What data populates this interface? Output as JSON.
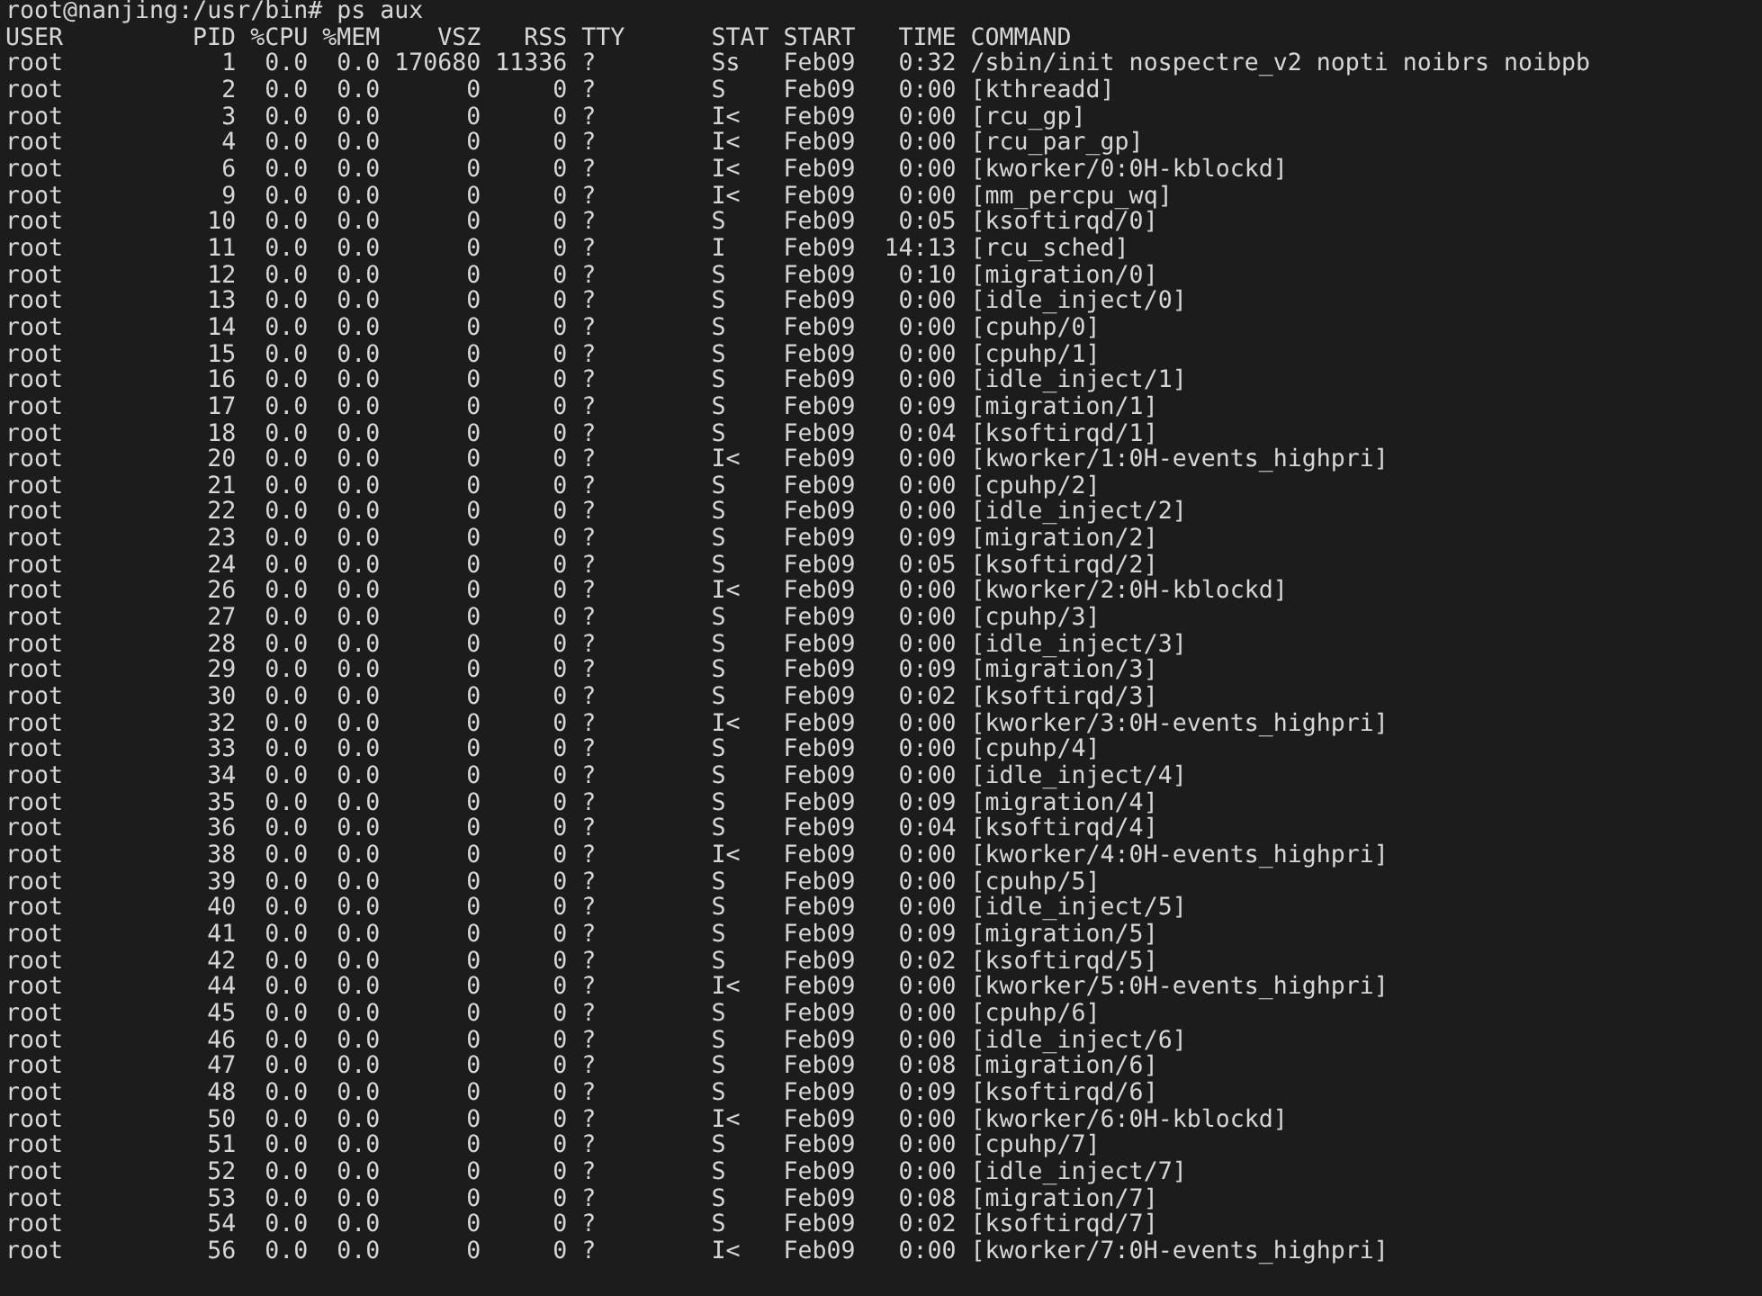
{
  "terminal": {
    "prompt": "root@nanjing:/usr/bin# ps aux",
    "columns": [
      "USER",
      "PID",
      "%CPU",
      "%MEM",
      "VSZ",
      "RSS",
      "TTY",
      "STAT",
      "START",
      "TIME",
      "COMMAND"
    ],
    "rows": [
      [
        "root",
        "1",
        "0.0",
        "0.0",
        "170680",
        "11336",
        "?",
        "Ss",
        "Feb09",
        "0:32",
        "/sbin/init nospectre_v2 nopti noibrs noibpb"
      ],
      [
        "root",
        "2",
        "0.0",
        "0.0",
        "0",
        "0",
        "?",
        "S",
        "Feb09",
        "0:00",
        "[kthreadd]"
      ],
      [
        "root",
        "3",
        "0.0",
        "0.0",
        "0",
        "0",
        "?",
        "I<",
        "Feb09",
        "0:00",
        "[rcu_gp]"
      ],
      [
        "root",
        "4",
        "0.0",
        "0.0",
        "0",
        "0",
        "?",
        "I<",
        "Feb09",
        "0:00",
        "[rcu_par_gp]"
      ],
      [
        "root",
        "6",
        "0.0",
        "0.0",
        "0",
        "0",
        "?",
        "I<",
        "Feb09",
        "0:00",
        "[kworker/0:0H-kblockd]"
      ],
      [
        "root",
        "9",
        "0.0",
        "0.0",
        "0",
        "0",
        "?",
        "I<",
        "Feb09",
        "0:00",
        "[mm_percpu_wq]"
      ],
      [
        "root",
        "10",
        "0.0",
        "0.0",
        "0",
        "0",
        "?",
        "S",
        "Feb09",
        "0:05",
        "[ksoftirqd/0]"
      ],
      [
        "root",
        "11",
        "0.0",
        "0.0",
        "0",
        "0",
        "?",
        "I",
        "Feb09",
        "14:13",
        "[rcu_sched]"
      ],
      [
        "root",
        "12",
        "0.0",
        "0.0",
        "0",
        "0",
        "?",
        "S",
        "Feb09",
        "0:10",
        "[migration/0]"
      ],
      [
        "root",
        "13",
        "0.0",
        "0.0",
        "0",
        "0",
        "?",
        "S",
        "Feb09",
        "0:00",
        "[idle_inject/0]"
      ],
      [
        "root",
        "14",
        "0.0",
        "0.0",
        "0",
        "0",
        "?",
        "S",
        "Feb09",
        "0:00",
        "[cpuhp/0]"
      ],
      [
        "root",
        "15",
        "0.0",
        "0.0",
        "0",
        "0",
        "?",
        "S",
        "Feb09",
        "0:00",
        "[cpuhp/1]"
      ],
      [
        "root",
        "16",
        "0.0",
        "0.0",
        "0",
        "0",
        "?",
        "S",
        "Feb09",
        "0:00",
        "[idle_inject/1]"
      ],
      [
        "root",
        "17",
        "0.0",
        "0.0",
        "0",
        "0",
        "?",
        "S",
        "Feb09",
        "0:09",
        "[migration/1]"
      ],
      [
        "root",
        "18",
        "0.0",
        "0.0",
        "0",
        "0",
        "?",
        "S",
        "Feb09",
        "0:04",
        "[ksoftirqd/1]"
      ],
      [
        "root",
        "20",
        "0.0",
        "0.0",
        "0",
        "0",
        "?",
        "I<",
        "Feb09",
        "0:00",
        "[kworker/1:0H-events_highpri]"
      ],
      [
        "root",
        "21",
        "0.0",
        "0.0",
        "0",
        "0",
        "?",
        "S",
        "Feb09",
        "0:00",
        "[cpuhp/2]"
      ],
      [
        "root",
        "22",
        "0.0",
        "0.0",
        "0",
        "0",
        "?",
        "S",
        "Feb09",
        "0:00",
        "[idle_inject/2]"
      ],
      [
        "root",
        "23",
        "0.0",
        "0.0",
        "0",
        "0",
        "?",
        "S",
        "Feb09",
        "0:09",
        "[migration/2]"
      ],
      [
        "root",
        "24",
        "0.0",
        "0.0",
        "0",
        "0",
        "?",
        "S",
        "Feb09",
        "0:05",
        "[ksoftirqd/2]"
      ],
      [
        "root",
        "26",
        "0.0",
        "0.0",
        "0",
        "0",
        "?",
        "I<",
        "Feb09",
        "0:00",
        "[kworker/2:0H-kblockd]"
      ],
      [
        "root",
        "27",
        "0.0",
        "0.0",
        "0",
        "0",
        "?",
        "S",
        "Feb09",
        "0:00",
        "[cpuhp/3]"
      ],
      [
        "root",
        "28",
        "0.0",
        "0.0",
        "0",
        "0",
        "?",
        "S",
        "Feb09",
        "0:00",
        "[idle_inject/3]"
      ],
      [
        "root",
        "29",
        "0.0",
        "0.0",
        "0",
        "0",
        "?",
        "S",
        "Feb09",
        "0:09",
        "[migration/3]"
      ],
      [
        "root",
        "30",
        "0.0",
        "0.0",
        "0",
        "0",
        "?",
        "S",
        "Feb09",
        "0:02",
        "[ksoftirqd/3]"
      ],
      [
        "root",
        "32",
        "0.0",
        "0.0",
        "0",
        "0",
        "?",
        "I<",
        "Feb09",
        "0:00",
        "[kworker/3:0H-events_highpri]"
      ],
      [
        "root",
        "33",
        "0.0",
        "0.0",
        "0",
        "0",
        "?",
        "S",
        "Feb09",
        "0:00",
        "[cpuhp/4]"
      ],
      [
        "root",
        "34",
        "0.0",
        "0.0",
        "0",
        "0",
        "?",
        "S",
        "Feb09",
        "0:00",
        "[idle_inject/4]"
      ],
      [
        "root",
        "35",
        "0.0",
        "0.0",
        "0",
        "0",
        "?",
        "S",
        "Feb09",
        "0:09",
        "[migration/4]"
      ],
      [
        "root",
        "36",
        "0.0",
        "0.0",
        "0",
        "0",
        "?",
        "S",
        "Feb09",
        "0:04",
        "[ksoftirqd/4]"
      ],
      [
        "root",
        "38",
        "0.0",
        "0.0",
        "0",
        "0",
        "?",
        "I<",
        "Feb09",
        "0:00",
        "[kworker/4:0H-events_highpri]"
      ],
      [
        "root",
        "39",
        "0.0",
        "0.0",
        "0",
        "0",
        "?",
        "S",
        "Feb09",
        "0:00",
        "[cpuhp/5]"
      ],
      [
        "root",
        "40",
        "0.0",
        "0.0",
        "0",
        "0",
        "?",
        "S",
        "Feb09",
        "0:00",
        "[idle_inject/5]"
      ],
      [
        "root",
        "41",
        "0.0",
        "0.0",
        "0",
        "0",
        "?",
        "S",
        "Feb09",
        "0:09",
        "[migration/5]"
      ],
      [
        "root",
        "42",
        "0.0",
        "0.0",
        "0",
        "0",
        "?",
        "S",
        "Feb09",
        "0:02",
        "[ksoftirqd/5]"
      ],
      [
        "root",
        "44",
        "0.0",
        "0.0",
        "0",
        "0",
        "?",
        "I<",
        "Feb09",
        "0:00",
        "[kworker/5:0H-events_highpri]"
      ],
      [
        "root",
        "45",
        "0.0",
        "0.0",
        "0",
        "0",
        "?",
        "S",
        "Feb09",
        "0:00",
        "[cpuhp/6]"
      ],
      [
        "root",
        "46",
        "0.0",
        "0.0",
        "0",
        "0",
        "?",
        "S",
        "Feb09",
        "0:00",
        "[idle_inject/6]"
      ],
      [
        "root",
        "47",
        "0.0",
        "0.0",
        "0",
        "0",
        "?",
        "S",
        "Feb09",
        "0:08",
        "[migration/6]"
      ],
      [
        "root",
        "48",
        "0.0",
        "0.0",
        "0",
        "0",
        "?",
        "S",
        "Feb09",
        "0:09",
        "[ksoftirqd/6]"
      ],
      [
        "root",
        "50",
        "0.0",
        "0.0",
        "0",
        "0",
        "?",
        "I<",
        "Feb09",
        "0:00",
        "[kworker/6:0H-kblockd]"
      ],
      [
        "root",
        "51",
        "0.0",
        "0.0",
        "0",
        "0",
        "?",
        "S",
        "Feb09",
        "0:00",
        "[cpuhp/7]"
      ],
      [
        "root",
        "52",
        "0.0",
        "0.0",
        "0",
        "0",
        "?",
        "S",
        "Feb09",
        "0:00",
        "[idle_inject/7]"
      ],
      [
        "root",
        "53",
        "0.0",
        "0.0",
        "0",
        "0",
        "?",
        "S",
        "Feb09",
        "0:08",
        "[migration/7]"
      ],
      [
        "root",
        "54",
        "0.0",
        "0.0",
        "0",
        "0",
        "?",
        "S",
        "Feb09",
        "0:02",
        "[ksoftirqd/7]"
      ],
      [
        "root",
        "56",
        "0.0",
        "0.0",
        "0",
        "0",
        "?",
        "I<",
        "Feb09",
        "0:00",
        "[kworker/7:0H-events_highpri]"
      ]
    ]
  }
}
